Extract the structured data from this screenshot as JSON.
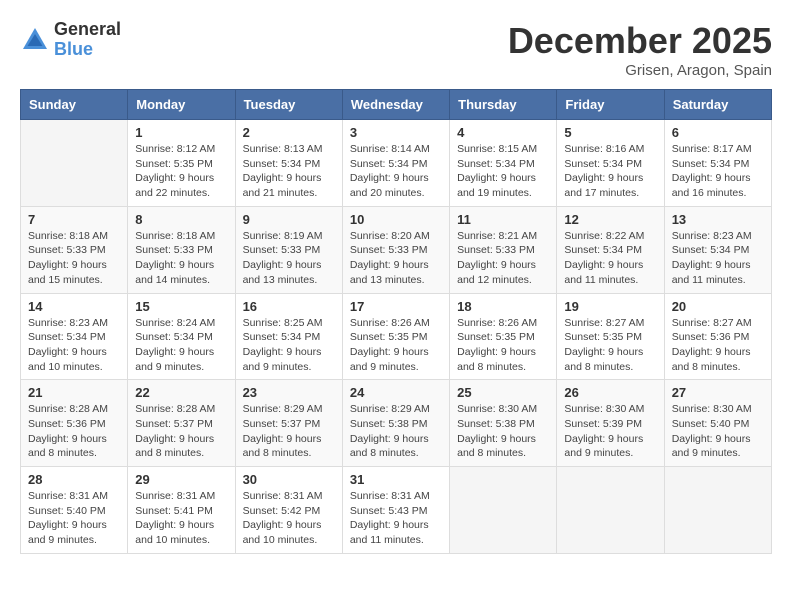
{
  "logo": {
    "general": "General",
    "blue": "Blue"
  },
  "title": "December 2025",
  "location": "Grisen, Aragon, Spain",
  "days_header": [
    "Sunday",
    "Monday",
    "Tuesday",
    "Wednesday",
    "Thursday",
    "Friday",
    "Saturday"
  ],
  "weeks": [
    [
      {
        "day": "",
        "sunrise": "",
        "sunset": "",
        "daylight": ""
      },
      {
        "day": "1",
        "sunrise": "Sunrise: 8:12 AM",
        "sunset": "Sunset: 5:35 PM",
        "daylight": "Daylight: 9 hours and 22 minutes."
      },
      {
        "day": "2",
        "sunrise": "Sunrise: 8:13 AM",
        "sunset": "Sunset: 5:34 PM",
        "daylight": "Daylight: 9 hours and 21 minutes."
      },
      {
        "day": "3",
        "sunrise": "Sunrise: 8:14 AM",
        "sunset": "Sunset: 5:34 PM",
        "daylight": "Daylight: 9 hours and 20 minutes."
      },
      {
        "day": "4",
        "sunrise": "Sunrise: 8:15 AM",
        "sunset": "Sunset: 5:34 PM",
        "daylight": "Daylight: 9 hours and 19 minutes."
      },
      {
        "day": "5",
        "sunrise": "Sunrise: 8:16 AM",
        "sunset": "Sunset: 5:34 PM",
        "daylight": "Daylight: 9 hours and 17 minutes."
      },
      {
        "day": "6",
        "sunrise": "Sunrise: 8:17 AM",
        "sunset": "Sunset: 5:34 PM",
        "daylight": "Daylight: 9 hours and 16 minutes."
      }
    ],
    [
      {
        "day": "7",
        "sunrise": "Sunrise: 8:18 AM",
        "sunset": "Sunset: 5:33 PM",
        "daylight": "Daylight: 9 hours and 15 minutes."
      },
      {
        "day": "8",
        "sunrise": "Sunrise: 8:18 AM",
        "sunset": "Sunset: 5:33 PM",
        "daylight": "Daylight: 9 hours and 14 minutes."
      },
      {
        "day": "9",
        "sunrise": "Sunrise: 8:19 AM",
        "sunset": "Sunset: 5:33 PM",
        "daylight": "Daylight: 9 hours and 13 minutes."
      },
      {
        "day": "10",
        "sunrise": "Sunrise: 8:20 AM",
        "sunset": "Sunset: 5:33 PM",
        "daylight": "Daylight: 9 hours and 13 minutes."
      },
      {
        "day": "11",
        "sunrise": "Sunrise: 8:21 AM",
        "sunset": "Sunset: 5:33 PM",
        "daylight": "Daylight: 9 hours and 12 minutes."
      },
      {
        "day": "12",
        "sunrise": "Sunrise: 8:22 AM",
        "sunset": "Sunset: 5:34 PM",
        "daylight": "Daylight: 9 hours and 11 minutes."
      },
      {
        "day": "13",
        "sunrise": "Sunrise: 8:23 AM",
        "sunset": "Sunset: 5:34 PM",
        "daylight": "Daylight: 9 hours and 11 minutes."
      }
    ],
    [
      {
        "day": "14",
        "sunrise": "Sunrise: 8:23 AM",
        "sunset": "Sunset: 5:34 PM",
        "daylight": "Daylight: 9 hours and 10 minutes."
      },
      {
        "day": "15",
        "sunrise": "Sunrise: 8:24 AM",
        "sunset": "Sunset: 5:34 PM",
        "daylight": "Daylight: 9 hours and 9 minutes."
      },
      {
        "day": "16",
        "sunrise": "Sunrise: 8:25 AM",
        "sunset": "Sunset: 5:34 PM",
        "daylight": "Daylight: 9 hours and 9 minutes."
      },
      {
        "day": "17",
        "sunrise": "Sunrise: 8:26 AM",
        "sunset": "Sunset: 5:35 PM",
        "daylight": "Daylight: 9 hours and 9 minutes."
      },
      {
        "day": "18",
        "sunrise": "Sunrise: 8:26 AM",
        "sunset": "Sunset: 5:35 PM",
        "daylight": "Daylight: 9 hours and 8 minutes."
      },
      {
        "day": "19",
        "sunrise": "Sunrise: 8:27 AM",
        "sunset": "Sunset: 5:35 PM",
        "daylight": "Daylight: 9 hours and 8 minutes."
      },
      {
        "day": "20",
        "sunrise": "Sunrise: 8:27 AM",
        "sunset": "Sunset: 5:36 PM",
        "daylight": "Daylight: 9 hours and 8 minutes."
      }
    ],
    [
      {
        "day": "21",
        "sunrise": "Sunrise: 8:28 AM",
        "sunset": "Sunset: 5:36 PM",
        "daylight": "Daylight: 9 hours and 8 minutes."
      },
      {
        "day": "22",
        "sunrise": "Sunrise: 8:28 AM",
        "sunset": "Sunset: 5:37 PM",
        "daylight": "Daylight: 9 hours and 8 minutes."
      },
      {
        "day": "23",
        "sunrise": "Sunrise: 8:29 AM",
        "sunset": "Sunset: 5:37 PM",
        "daylight": "Daylight: 9 hours and 8 minutes."
      },
      {
        "day": "24",
        "sunrise": "Sunrise: 8:29 AM",
        "sunset": "Sunset: 5:38 PM",
        "daylight": "Daylight: 9 hours and 8 minutes."
      },
      {
        "day": "25",
        "sunrise": "Sunrise: 8:30 AM",
        "sunset": "Sunset: 5:38 PM",
        "daylight": "Daylight: 9 hours and 8 minutes."
      },
      {
        "day": "26",
        "sunrise": "Sunrise: 8:30 AM",
        "sunset": "Sunset: 5:39 PM",
        "daylight": "Daylight: 9 hours and 9 minutes."
      },
      {
        "day": "27",
        "sunrise": "Sunrise: 8:30 AM",
        "sunset": "Sunset: 5:40 PM",
        "daylight": "Daylight: 9 hours and 9 minutes."
      }
    ],
    [
      {
        "day": "28",
        "sunrise": "Sunrise: 8:31 AM",
        "sunset": "Sunset: 5:40 PM",
        "daylight": "Daylight: 9 hours and 9 minutes."
      },
      {
        "day": "29",
        "sunrise": "Sunrise: 8:31 AM",
        "sunset": "Sunset: 5:41 PM",
        "daylight": "Daylight: 9 hours and 10 minutes."
      },
      {
        "day": "30",
        "sunrise": "Sunrise: 8:31 AM",
        "sunset": "Sunset: 5:42 PM",
        "daylight": "Daylight: 9 hours and 10 minutes."
      },
      {
        "day": "31",
        "sunrise": "Sunrise: 8:31 AM",
        "sunset": "Sunset: 5:43 PM",
        "daylight": "Daylight: 9 hours and 11 minutes."
      },
      {
        "day": "",
        "sunrise": "",
        "sunset": "",
        "daylight": ""
      },
      {
        "day": "",
        "sunrise": "",
        "sunset": "",
        "daylight": ""
      },
      {
        "day": "",
        "sunrise": "",
        "sunset": "",
        "daylight": ""
      }
    ]
  ]
}
